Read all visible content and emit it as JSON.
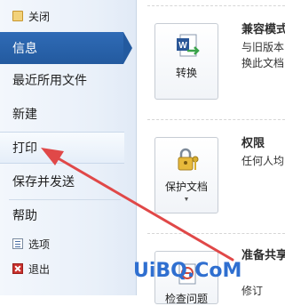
{
  "nav": {
    "close": "关闭",
    "info": "信息",
    "recent": "最近所用文件",
    "new": "新建",
    "print": "打印",
    "save_send": "保存并发送",
    "help": "帮助",
    "options": "选项",
    "exit": "退出"
  },
  "sections": [
    {
      "title": "兼容模式",
      "desc_lines": [
        "与旧版本",
        "换此文档"
      ],
      "button": "转换"
    },
    {
      "title": "权限",
      "desc_lines": [
        "任何人均"
      ],
      "button": "保护文档"
    },
    {
      "title": "准备共享",
      "desc_lines": [
        "修订"
      ],
      "button": "检查问题"
    }
  ],
  "watermark": "UiBQ.CoM",
  "colors": {
    "active_nav": "#2f6bb6",
    "annotation_arrow": "#e04848",
    "watermark": "#2f6fd0"
  }
}
